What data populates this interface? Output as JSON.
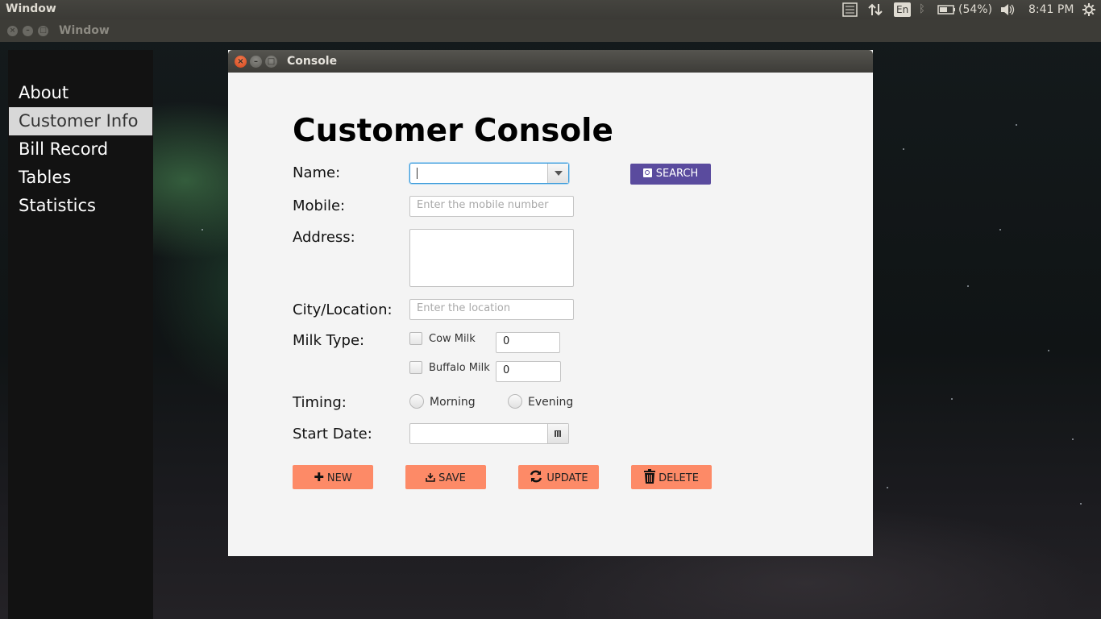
{
  "top_panel": {
    "app_title": "Window",
    "keyboard_layout": "En",
    "battery": "(54%)",
    "time": "8:41 PM"
  },
  "outer_window": {
    "title": "Window"
  },
  "sidebar": {
    "items": [
      {
        "label": "About",
        "active": false
      },
      {
        "label": "Customer Info",
        "active": true
      },
      {
        "label": "Bill Record",
        "active": false
      },
      {
        "label": "Tables",
        "active": false
      },
      {
        "label": "Statistics",
        "active": false
      }
    ]
  },
  "console": {
    "title": "Console",
    "heading": "Customer Console",
    "labels": {
      "name": "Name:",
      "mobile": "Mobile:",
      "address": "Address:",
      "city": "City/Location:",
      "milk_type": "Milk Type:",
      "timing": "Timing:",
      "start_date": "Start Date:"
    },
    "name_value": "",
    "mobile_placeholder": "Enter the mobile number",
    "address_value": "",
    "city_placeholder": "Enter the location",
    "search_label": "SEARCH",
    "milk": {
      "cow_label": "Cow Milk",
      "cow_checked": false,
      "cow_qty": "0",
      "buffalo_label": "Buffalo Milk",
      "buffalo_checked": false,
      "buffalo_qty": "0"
    },
    "timing": {
      "morning_label": "Morning",
      "evening_label": "Evening"
    },
    "start_date_value": "",
    "actions": {
      "new_label": "NEW",
      "save_label": "SAVE",
      "update_label": "UPDATE",
      "delete_label": "DELETE"
    }
  },
  "colors": {
    "search_button": "#5a4b9e",
    "action_button": "#fd8a67",
    "active_sidebar": "#d8d8d8"
  }
}
